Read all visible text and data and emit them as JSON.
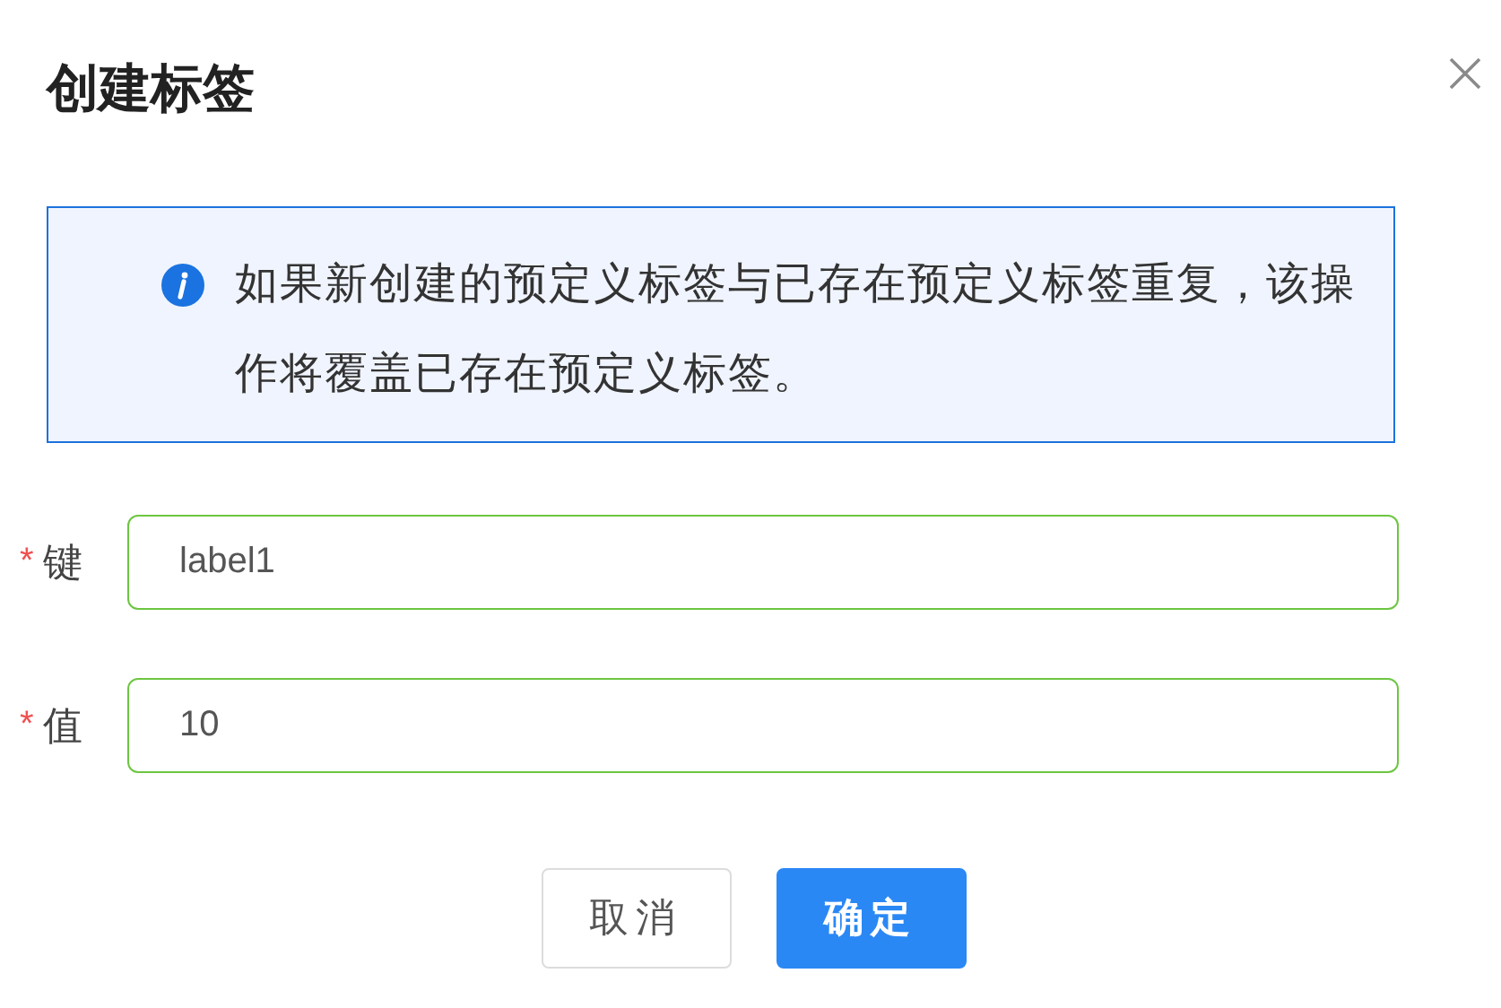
{
  "dialog": {
    "title": "创建标签"
  },
  "notice": {
    "text": "如果新创建的预定义标签与已存在预定义标签重复，该操作将覆盖已存在预定义标签。"
  },
  "fields": [
    {
      "marker": "*",
      "label": "键",
      "value": "label1"
    },
    {
      "marker": "*",
      "label": "值",
      "value": "10"
    }
  ],
  "buttons": [
    {
      "label": "取消",
      "kind": "default"
    },
    {
      "label": "确定",
      "kind": "primary"
    }
  ]
}
